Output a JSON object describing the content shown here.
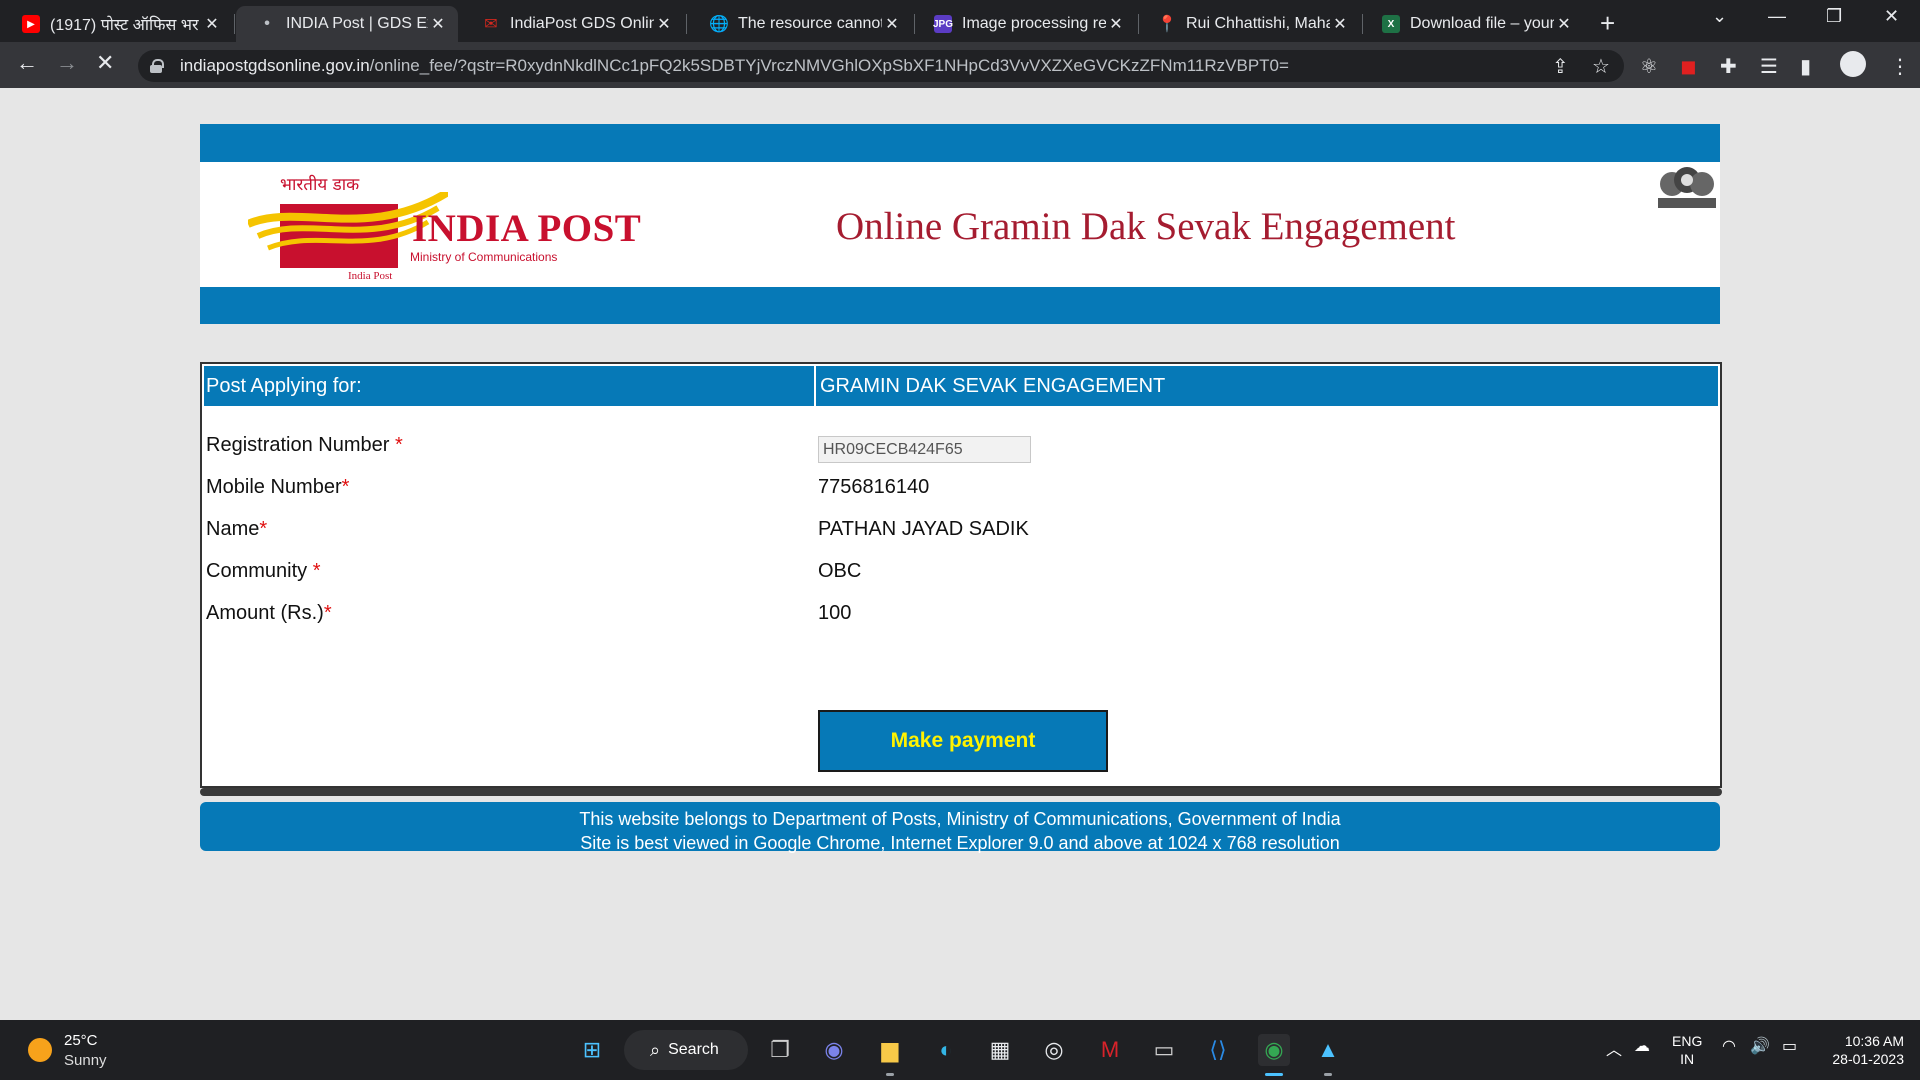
{
  "browser": {
    "tabs": [
      {
        "title": "(1917) पोस्ट ऑफिस भर",
        "favicon": "youtube-icon",
        "active": false
      },
      {
        "title": "INDIA Post | GDS Exam",
        "favicon": "loading-dot-icon",
        "active": true
      },
      {
        "title": "IndiaPost GDS Online",
        "favicon": "indiapost-icon",
        "active": false
      },
      {
        "title": "The resource cannot b",
        "favicon": "globe-icon",
        "active": false
      },
      {
        "title": "Image processing resu",
        "favicon": "jpg-icon",
        "active": false
      },
      {
        "title": "Rui Chhattishi, Mahar",
        "favicon": "maps-pin-icon",
        "active": false
      },
      {
        "title": "Download file – your",
        "favicon": "excel-icon",
        "active": false
      }
    ],
    "url_host": "indiapostgdsonline.gov.in",
    "url_path": "/online_fee/?qstr=R0xydnNkdlNCc1pFQ2k5SDBTYjVrczNMVGhlOXpSbXF1NHpCd3VvVXZXeGVCKzZFNm11RzVBPT0="
  },
  "header": {
    "logo_hindi": "भारतीय डाक",
    "logo_brand": "INDIA POST",
    "logo_ministry": "Ministry of Communications",
    "logo_small": "India Post",
    "site_title": "Online Gramin Dak Sevak Engagement"
  },
  "form": {
    "head_label": "Post Applying for:",
    "head_value": "GRAMIN DAK SEVAK ENGAGEMENT",
    "rows": [
      {
        "label": "Registration  Number ",
        "req": "*",
        "value": "HR09CECB424F65"
      },
      {
        "label": "Mobile Number",
        "req": "*",
        "value": "7756816140"
      },
      {
        "label": "Name",
        "req": "*",
        "value": "PATHAN JAYAD SADIK"
      },
      {
        "label": "Community ",
        "req": "*",
        "value": "OBC"
      },
      {
        "label": "Amount (Rs.)",
        "req": "*",
        "value": "100"
      }
    ],
    "pay_button": "Make payment"
  },
  "footer": {
    "line1": "This website belongs to Department of Posts, Ministry of Communications, Government of India",
    "line2": "Site is best viewed in Google Chrome, Internet Explorer 9.0 and above at 1024 x 768 resolution"
  },
  "taskbar": {
    "temperature": "25°C",
    "condition": "Sunny",
    "search_label": "Search",
    "lang_top": "ENG",
    "lang_bottom": "IN",
    "time": "10:36 AM",
    "date": "28-01-2023"
  },
  "colors": {
    "header_blue": "#0679b7",
    "brand_red": "#c8102e",
    "button_text": "#fff200",
    "required": "#e01010"
  }
}
